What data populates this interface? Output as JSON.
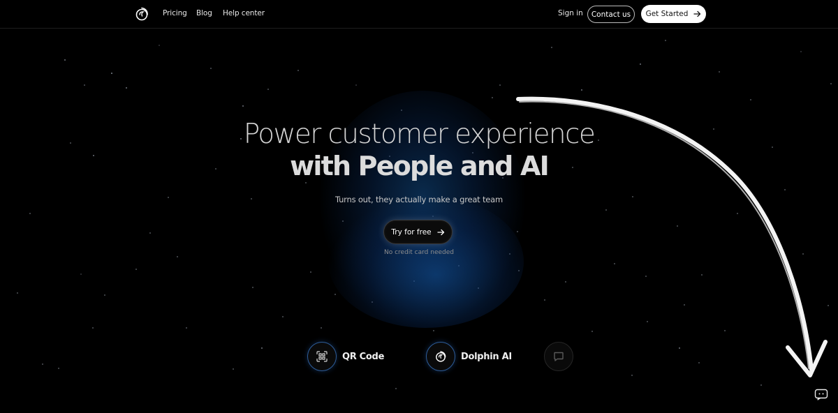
{
  "header": {
    "nav": [
      "Pricing",
      "Blog",
      "Help center"
    ],
    "sign_in": "Sign in",
    "contact": "Contact us",
    "get_started": "Get Started"
  },
  "hero": {
    "line1": "Power customer experience",
    "line2": "with People and AI",
    "subtitle": "Turns out, they actually make a great team",
    "cta": "Try for free",
    "cta_note": "No credit card needed"
  },
  "features": [
    {
      "label": "QR Code",
      "icon": "qr-code-icon"
    },
    {
      "label": "Dolphin AI",
      "icon": "dolphin-logo-icon"
    },
    {
      "label": "",
      "icon": "chat-bubble-icon"
    }
  ],
  "colors": {
    "background": "#000000",
    "accent_glow": "#124e8c",
    "button_white": "#ffffff",
    "text_primary": "#ffffff"
  },
  "icons": {
    "logo": "dolphin-logo-icon",
    "arrow": "arrow-right-icon",
    "chat_widget": "chat-widget-icon",
    "decorative_arrow": "hand-drawn-arrow"
  }
}
